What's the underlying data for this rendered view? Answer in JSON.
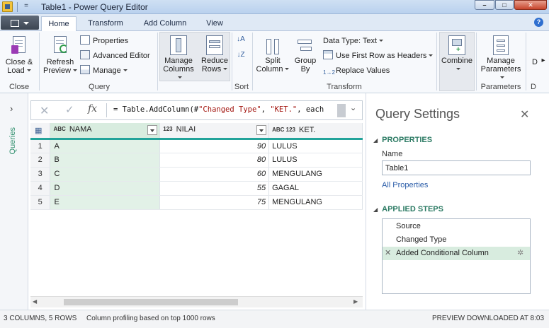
{
  "window": {
    "title": "Table1 - Power Query Editor",
    "menu_glyph": "=",
    "min_glyph": "–",
    "max_glyph": "□",
    "close_glyph": "✕"
  },
  "tabs": [
    {
      "label": "Home",
      "active": true
    },
    {
      "label": "Transform",
      "active": false
    },
    {
      "label": "Add Column",
      "active": false
    },
    {
      "label": "View",
      "active": false
    }
  ],
  "help_glyph": "?",
  "ribbon": {
    "close_load": {
      "line1": "Close &",
      "line2": "Load"
    },
    "refresh": {
      "line1": "Refresh",
      "line2": "Preview"
    },
    "properties": "Properties",
    "advanced_editor": "Advanced Editor",
    "manage": "Manage",
    "manage_columns": {
      "line1": "Manage",
      "line2": "Columns"
    },
    "reduce_rows": {
      "line1": "Reduce",
      "line2": "Rows"
    },
    "split_column": {
      "line1": "Split",
      "line2": "Column"
    },
    "group_by": {
      "line1": "Group",
      "line2": "By"
    },
    "data_type": "Data Type: Text",
    "first_row": "Use First Row as Headers",
    "replace_values": "Replace Values",
    "combine": "Combine",
    "manage_parameters": {
      "line1": "Manage",
      "line2": "Parameters"
    },
    "overflow": "D",
    "groups": {
      "close": "Close",
      "query": "Query",
      "sort": "Sort",
      "transform": "Transform",
      "parameters": "Parameters",
      "overflow": "D"
    }
  },
  "queries_pane": {
    "label": "Queries",
    "chevron": "›"
  },
  "formula_bar": {
    "cancel_glyph": "✕",
    "commit_glyph": "✓",
    "fx": "fx",
    "prefix": "= Table.AddColumn(#",
    "str1": "\"Changed Type\"",
    "mid": ", ",
    "str2": "\"KET.\"",
    "suffix": ", each",
    "expand_glyph": "⌄"
  },
  "grid": {
    "corner_glyph": "▦",
    "columns": [
      {
        "type": "ABC",
        "name": "NAMA"
      },
      {
        "type": "123",
        "name": "NILAI"
      },
      {
        "type": "ABC 123",
        "name": "KET."
      }
    ],
    "rows": [
      {
        "n": "1",
        "nama": "A",
        "nilai": "90",
        "ket": "LULUS"
      },
      {
        "n": "2",
        "nama": "B",
        "nilai": "80",
        "ket": "LULUS"
      },
      {
        "n": "3",
        "nama": "C",
        "nilai": "60",
        "ket": "MENGULANG"
      },
      {
        "n": "4",
        "nama": "D",
        "nilai": "55",
        "ket": "GAGAL"
      },
      {
        "n": "5",
        "nama": "E",
        "nilai": "75",
        "ket": "MENGULANG"
      }
    ],
    "scroll_left": "◀",
    "scroll_right": "▶"
  },
  "query_settings": {
    "title": "Query Settings",
    "close_glyph": "✕",
    "properties_header": "PROPERTIES",
    "name_label": "Name",
    "name_value": "Table1",
    "all_properties": "All Properties",
    "applied_steps_header": "APPLIED STEPS",
    "steps": [
      {
        "label": "Source",
        "selected": false
      },
      {
        "label": "Changed Type",
        "selected": false
      },
      {
        "label": "Added Conditional Column",
        "selected": true
      }
    ],
    "delete_glyph": "✕",
    "gear_glyph": "✲",
    "section_glyph": "◢"
  },
  "status": {
    "counts": "3 COLUMNS, 5 ROWS",
    "profiling": "Column profiling based on top 1000 rows",
    "preview": "PREVIEW DOWNLOADED AT 8:03"
  }
}
